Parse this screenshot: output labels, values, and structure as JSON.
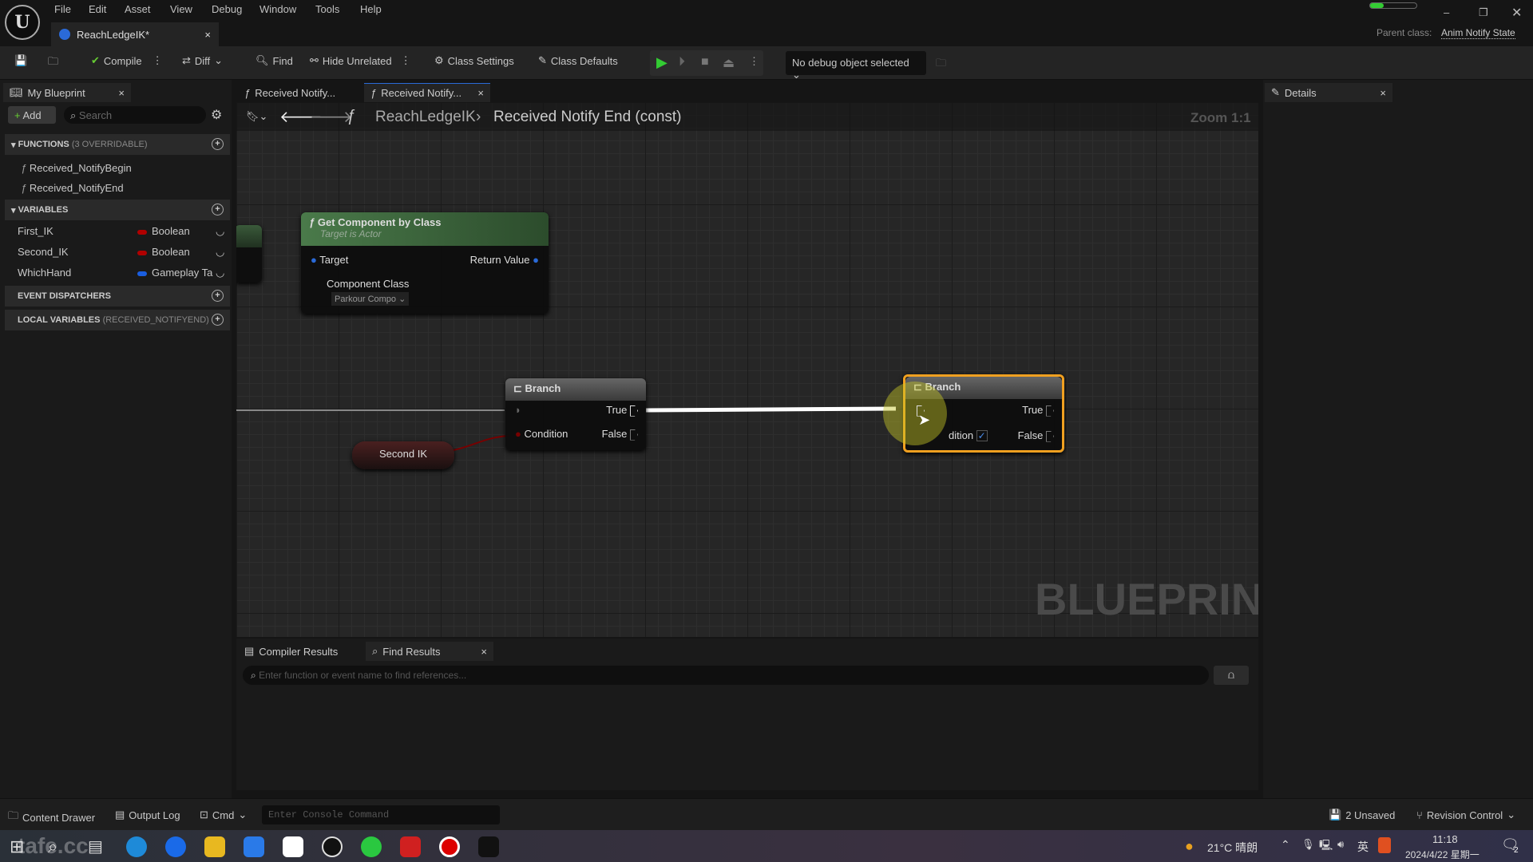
{
  "menu": [
    "File",
    "Edit",
    "Asset",
    "View",
    "Debug",
    "Window",
    "Tools",
    "Help"
  ],
  "doc_tab": {
    "title": "ReachLedgeIK*"
  },
  "parent_class": {
    "label": "Parent class:",
    "value": "Anim Notify State"
  },
  "toolbar": {
    "compile": "Compile",
    "diff": "Diff",
    "find": "Find",
    "hide_unrelated": "Hide Unrelated",
    "class_settings": "Class Settings",
    "class_defaults": "Class Defaults",
    "debug_object": "No debug object selected"
  },
  "my_blueprint": {
    "tab": "My Blueprint",
    "add": "Add",
    "search_placeholder": "Search",
    "functions": {
      "title": "FUNCTIONS",
      "sub": "(3 OVERRIDABLE)",
      "items": [
        "Received_NotifyBegin",
        "Received_NotifyEnd"
      ]
    },
    "variables": {
      "title": "VARIABLES",
      "items": [
        {
          "name": "First_IK",
          "type": "Boolean",
          "color": "#b00000"
        },
        {
          "name": "Second_IK",
          "type": "Boolean",
          "color": "#b00000"
        },
        {
          "name": "WhichHand",
          "type": "Gameplay Ta",
          "color": "#1a5ee0"
        }
      ]
    },
    "event_dispatchers": "EVENT DISPATCHERS",
    "local_variables": {
      "title": "LOCAL VARIABLES",
      "sub": "(RECEIVED_NOTIFYEND)"
    }
  },
  "graph_tabs": [
    "Received Notify...",
    "Received Notify..."
  ],
  "breadcrumb": {
    "root": "ReachLedgeIK",
    "current": "Received Notify End (const)"
  },
  "zoom": "Zoom 1:1",
  "watermark": "BLUEPRINT",
  "nodes": {
    "get_component": {
      "title": "Get Component by Class",
      "subtitle": "Target is Actor",
      "target": "Target",
      "return": "Return Value",
      "component_class": "Component Class",
      "class_value": "Parkour Compo"
    },
    "branch1": {
      "title": "Branch",
      "true": "True",
      "false": "False",
      "condition": "Condition"
    },
    "second_ik": "Second IK",
    "branch2": {
      "title": "Branch",
      "true": "True",
      "false": "False",
      "condition": "dition"
    }
  },
  "details": {
    "tab": "Details"
  },
  "bottom": {
    "tabs": [
      "Compiler Results",
      "Find Results"
    ],
    "search_placeholder": "Enter function or event name to find references..."
  },
  "status": {
    "content_drawer": "Content Drawer",
    "output_log": "Output Log",
    "cmd": "Cmd",
    "console_placeholder": "Enter Console Command",
    "unsaved": "2 Unsaved",
    "revision": "Revision Control"
  },
  "taskbar": {
    "weather": "21°C 晴朗",
    "ime": "英",
    "time": "11:18",
    "date": "2024/4/22 星期一",
    "notifications": "2",
    "watermark": "tafe.cc"
  }
}
